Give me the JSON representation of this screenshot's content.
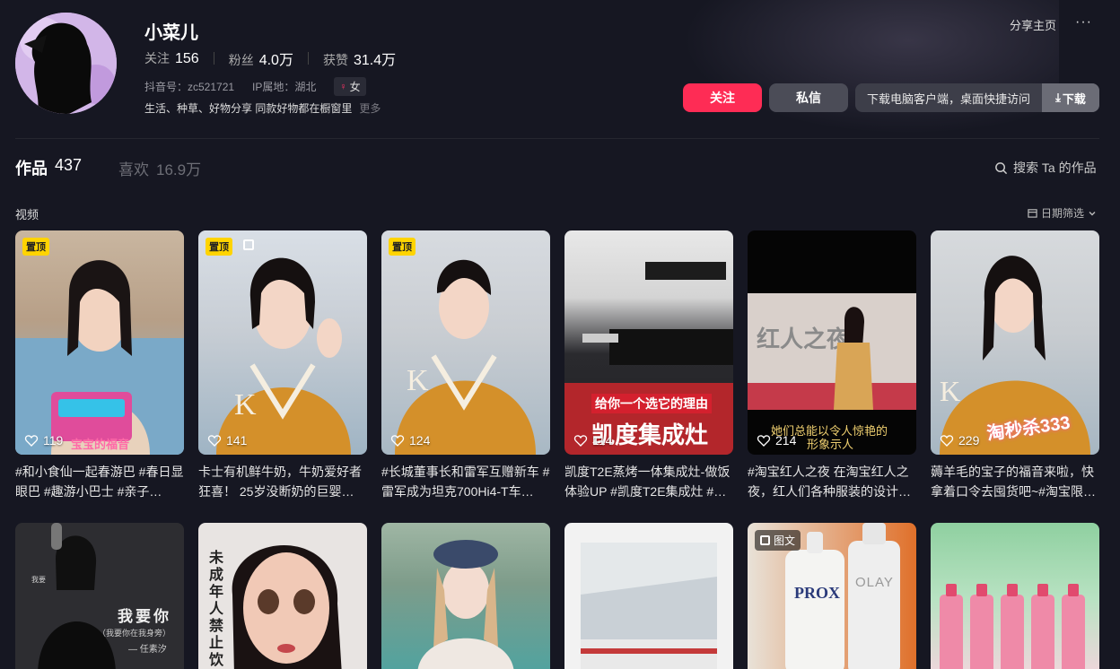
{
  "profile": {
    "name": "小菜儿",
    "following_label": "关注",
    "following": "156",
    "followers_label": "粉丝",
    "followers": "4.0万",
    "likes_label": "获赞",
    "likes": "31.4万",
    "douyin_id": "抖音号：zc521721",
    "ip": "IP属地：湖北",
    "gender": "女",
    "bio": "生活、种草、好物分享 同款好物都在橱窗里",
    "more": "更多"
  },
  "header": {
    "share": "分享主页",
    "more_dots": "···",
    "follow_btn": "关注",
    "message_btn": "私信",
    "download_text": "下载电脑客户端，桌面快捷访问",
    "download_btn": "下载"
  },
  "tabs": {
    "works_label": "作品",
    "works_count": "437",
    "likes_label": "喜欢",
    "likes_count": "16.9万",
    "search": "搜索 Ta 的作品"
  },
  "section": {
    "label": "视频",
    "date_filter": "日期筛选"
  },
  "videos": [
    {
      "pinned": "置顶",
      "likes": "119",
      "caption": "#和小食仙一起春游巴 #春日显眼巴 #趣游小巴士 #亲子…",
      "overlay": "宝宝的福音"
    },
    {
      "pinned": "置顶",
      "likes": "141",
      "caption": "卡士有机鲜牛奶，牛奶爱好者狂喜！ 25岁没断奶的巨婴…"
    },
    {
      "pinned": "置顶",
      "likes": "124",
      "caption": "#长城董事长和雷军互赠新车 #雷军成为坦克700Hi4-T车…"
    },
    {
      "likes": "114",
      "caption": "凯度T2E蒸烤一体集成灶-做饭体验UP #凯度T2E集成灶 #…",
      "overlay": "凯度集成灶",
      "overlay2": "给你一个选它的理由"
    },
    {
      "likes": "214",
      "caption": "#淘宝红人之夜 在淘宝红人之夜，红人们各种服装的设计…",
      "overlay": "她们总能以令人惊艳的",
      "overlay2": "形象示人"
    },
    {
      "likes": "229",
      "caption": "薅羊毛的宝子的福音来啦，快拿着口令去囤货吧~#淘宝限…",
      "overlay": "淘秒杀333"
    }
  ],
  "row2": [
    {
      "overlay": "我要你",
      "overlay2": "（我要你在我身旁）",
      "overlay3": "— 任素汐",
      "side": "我要"
    },
    {
      "overlay": "未成年人禁止饮"
    },
    {},
    {},
    {
      "tuwen": "图文",
      "brand1": "PROX",
      "brand2": "OLAY"
    },
    {}
  ],
  "colors": {
    "accent": "#fe2c55",
    "pin": "#ffd400",
    "bg": "#161722"
  }
}
